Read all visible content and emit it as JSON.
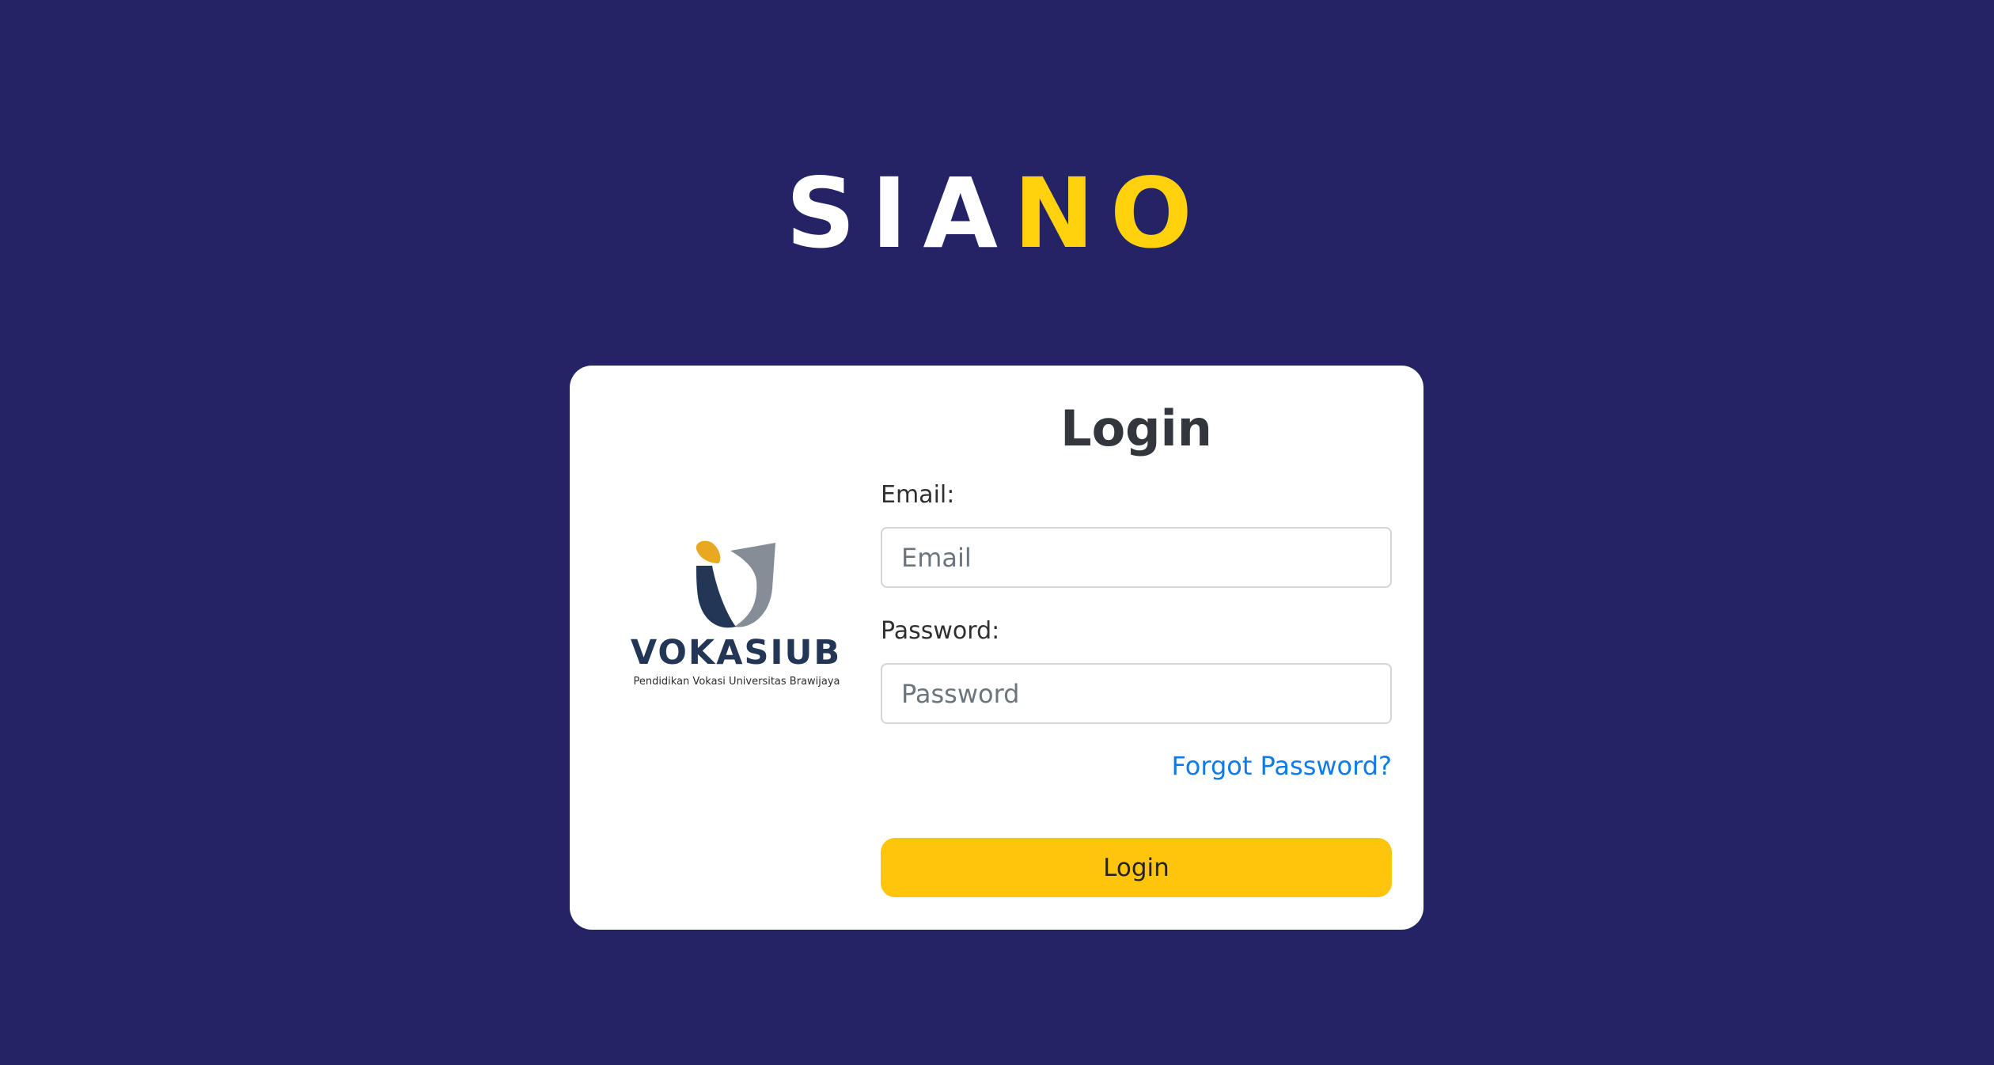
{
  "app_title": {
    "part_white": "SIA",
    "part_yellow": "NO",
    "white_color": "#ffffff",
    "yellow_color": "#ffd20d"
  },
  "logo": {
    "icon": "vokasi-ub-logo-icon",
    "wordmark": "VOKASIUB",
    "tagline": "Pendidikan Vokasi Universitas Brawijaya",
    "colors": {
      "navy": "#233656",
      "gray": "#858d97",
      "gold": "#e8a820"
    }
  },
  "login_form": {
    "heading": "Login",
    "email_label": "Email:",
    "email_placeholder": "Email",
    "email_value": "",
    "password_label": "Password:",
    "password_placeholder": "Password",
    "password_value": "",
    "forgot_password": "Forgot Password?",
    "submit_label": "Login"
  },
  "colors": {
    "background": "#232366",
    "card": "#ffffff",
    "button": "#ffc40c",
    "link": "#0f7be8"
  }
}
